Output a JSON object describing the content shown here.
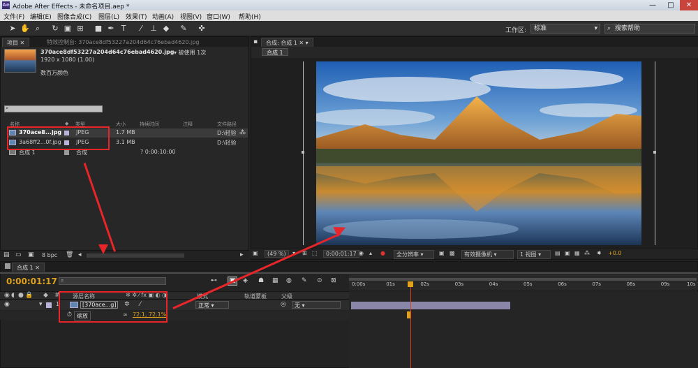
{
  "titlebar": {
    "logo_text": "Ae",
    "title": "Adobe After Effects - 未命名项目.aep *",
    "minimize": "—",
    "maximize": "□",
    "close": "✕"
  },
  "menu": [
    "文件(F)",
    "编辑(E)",
    "图像合成(C)",
    "图层(L)",
    "效果(T)",
    "动画(A)",
    "视图(V)",
    "窗口(W)",
    "帮助(H)"
  ],
  "toolbar": {
    "workspace_label": "工作区:",
    "workspace_value": "标准",
    "search_placeholder": "搜索帮助"
  },
  "project_panel": {
    "tab_project": "项目",
    "tab_effects": "特效控制台: 370ace8df53227a204d64c76ebad4620.jpg",
    "file_name": "370ace8df53227a204d64c76ebad4620.jpg",
    "used_count": "▾ 被使用 1次",
    "dimensions": "1920 x 1080 (1.00)",
    "color_depth": "数百万颜色",
    "columns": [
      "名称",
      "类型",
      "大小",
      "持续时间",
      "注释",
      "文件路径"
    ],
    "rows": [
      {
        "name": "370ace8...jpg",
        "type": "JPEG",
        "size": "1.7 MB",
        "duration": "",
        "path": "D:\\轻验"
      },
      {
        "name": "3a68ff2...0f.jpg",
        "type": "JPEG",
        "size": "3.1 MB",
        "duration": "",
        "path": "D:\\轻验"
      },
      {
        "name": "合成 1",
        "type": "合成",
        "size": "",
        "duration": "? 0:00:10:00",
        "path": ""
      }
    ],
    "bpc": "8 bpc"
  },
  "comp_panel": {
    "tab": "合成: 合成 1",
    "subtab": "合成 1",
    "zoom": "(49 %)",
    "timecode": "0:00:01:17",
    "resolution": "全分辨率",
    "camera": "有效摄像机",
    "views": "1 视图",
    "exposure": "+0.0"
  },
  "timeline": {
    "tab": "合成 1",
    "timecode": "0:00:01:17",
    "layer_header": "源层名称",
    "mode_header": "模式",
    "trkmat_header": "轨道蒙板",
    "parent_header": "父级",
    "layer_number": "1",
    "layer_name": "[370ace...g]",
    "mode_value": "正常",
    "parent_value": "无",
    "property_name": "缩放",
    "property_value": "72.1, 72.1%",
    "ruler": [
      "0:00s",
      "01s",
      "02s",
      "03s",
      "04s",
      "05s",
      "06s",
      "07s",
      "08s",
      "09s",
      "10s"
    ],
    "playhead_s": 1.7
  }
}
